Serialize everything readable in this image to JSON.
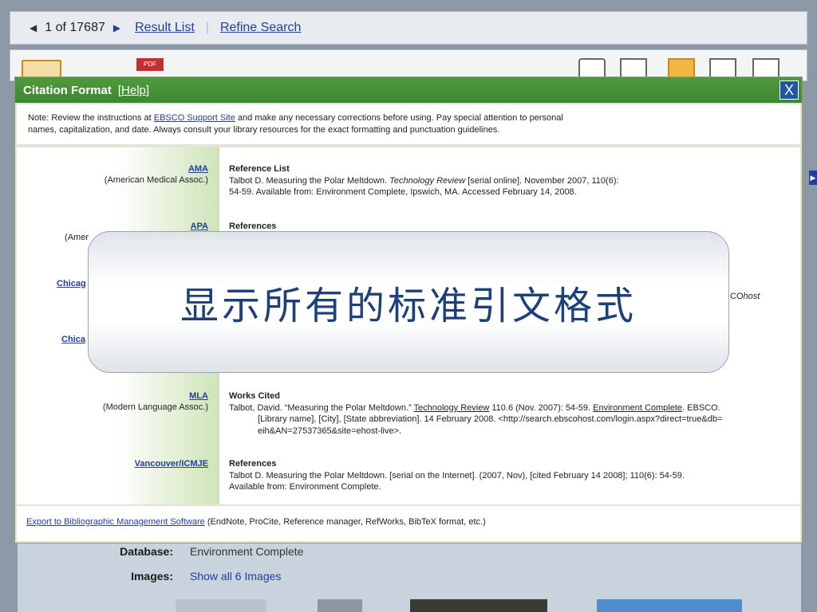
{
  "nav": {
    "position": "1 of 17687",
    "result_list": "Result List",
    "refine_search": "Refine Search"
  },
  "toolbar": {
    "pdf_label": "PDF"
  },
  "dialog": {
    "title": "Citation Format",
    "help_label": "Help",
    "close_label": "X",
    "note": {
      "prefix": "Note: Review the instructions at ",
      "link": "EBSCO Support Site",
      "suffix_line1": " and make any necessary corrections before using. Pay special attention to personal",
      "line2": "names, capitalization, and date. Always consult your library resources for the exact formatting and punctuation guidelines."
    },
    "citations": [
      {
        "style": "AMA",
        "style_full": "(American Medical Assoc.)",
        "heading": "Reference List",
        "text_a": "Talbot D. Measuring the Polar Meltdown. ",
        "text_journal": "Technology Review",
        "text_b": " [serial online]. November 2007, 110(6):",
        "text_c": "54-59. Available from: Environment Complete, Ipswich, MA. Accessed February 14, 2008."
      },
      {
        "style": "APA",
        "style_full": "(Amer",
        "heading": "References"
      },
      {
        "style": "Chicag"
      },
      {
        "style": "Chica"
      },
      {
        "style": "MLA",
        "style_full": "(Modern Language Assoc.)",
        "heading": "Works Cited",
        "text_a": "Talbot, David. “Measuring the Polar Meltdown.” ",
        "text_journal": "Technology Review",
        "text_b": " 110.6 (Nov. 2007): 54-59. ",
        "text_db": "Environment Complete",
        "text_c": ". EBSCO.",
        "text_d": "[Library name], [City], [State abbreviation]. 14 February 2008. <http://search.ebscohost.com/login.aspx?direct=true&db=",
        "text_e": "eih&AN=27537365&site=ehost-live>."
      },
      {
        "style": "Vancouver/ICMJE",
        "heading": "References",
        "text_a": "Talbot D. Measuring the Polar Meltdown. [serial on the Internet]. (2007, Nov), [cited February 14 2008]; 110(6): 54-59.",
        "text_b": "Available from: Environment Complete."
      }
    ],
    "chicago_fragment_a": "CO",
    "chicago_fragment_b": "host",
    "export": {
      "link": "Export to Bibliographic Management Software",
      "suffix": " (EndNote, ProCite, Reference manager, RefWorks, BibTeX format, etc.)"
    }
  },
  "record": {
    "database_label": "Database:",
    "database_value": "Environment Complete",
    "images_label": "Images:",
    "images_value": "Show all 6 Images"
  },
  "overlay": {
    "text": "显示所有的标准引文格式"
  },
  "colors": {
    "dialog_header": "#4f9a3d",
    "link": "#1f3f9a",
    "close_button": "#1d57a6"
  }
}
